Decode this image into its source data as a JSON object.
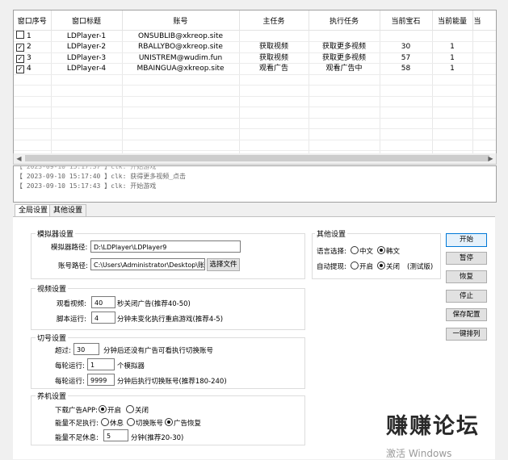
{
  "table": {
    "columns": [
      "窗口序号",
      "窗口标题",
      "账号",
      "主任务",
      "执行任务",
      "当前宝石",
      "当前能量",
      "当"
    ],
    "rows": [
      {
        "checked": false,
        "index": "1",
        "title": "LDPlayer-1",
        "account": "ONSUBLIB@xkreop.site",
        "main_task": "",
        "exec_task": "",
        "gems": "",
        "energy": ""
      },
      {
        "checked": true,
        "index": "2",
        "title": "LDPlayer-2",
        "account": "RBALLYBO@xkreop.site",
        "main_task": "获取视频",
        "exec_task": "获取更多视频",
        "gems": "30",
        "energy": "1"
      },
      {
        "checked": true,
        "index": "3",
        "title": "LDPlayer-3",
        "account": "UNISTREM@wudim.fun",
        "main_task": "获取视频",
        "exec_task": "获取更多视频",
        "gems": "57",
        "energy": "1"
      },
      {
        "checked": true,
        "index": "4",
        "title": "LDPlayer-4",
        "account": "MBAINGUA@xkreop.site",
        "main_task": "观看广告",
        "exec_task": "观看广告中",
        "gems": "58",
        "energy": "1"
      }
    ],
    "extra_mark": "2"
  },
  "log": [
    "【 2023-09-10 15:17:40 】clk: 获得更多视频_点击",
    "【 2023-09-10 15:17:43 】clk: 开始游戏"
  ],
  "tabs": [
    "全局设置",
    "其他设置"
  ],
  "emulator": {
    "group_title": "模拟器设置",
    "path_label": "模拟器路径:",
    "path_value": "D:\\LDPlayer\\LDPlayer9",
    "account_label": "账号路径:",
    "account_value": "C:\\Users\\Administrator\\Desktop\\账号1",
    "choose_file": "选择文件"
  },
  "video": {
    "group_title": "视频设置",
    "watch_label": "观看视频:",
    "watch_value": "40",
    "watch_suffix": "秒关闭广告(推荐40-50)",
    "script_label": "脚本运行:",
    "script_value": "4",
    "script_suffix": "分钟未变化执行重启游戏(推荐4-5)"
  },
  "switch": {
    "group_title": "切号设置",
    "exceed_label": "超过:",
    "exceed_value": "30",
    "exceed_suffix": "分钟后还没有广告可看执行切换账号",
    "per_round_label": "每轮运行:",
    "per_round_value": "1",
    "per_round_suffix": "个模拟器",
    "round_run_label": "每轮运行:",
    "round_run_value": "9999",
    "round_run_suffix": "分钟后执行切换账号(推荐180-240)"
  },
  "nurture": {
    "group_title": "养机设置",
    "download_label": "下载广告APP:",
    "download_on": "开启",
    "download_off": "关闭",
    "low_label": "能量不足执行:",
    "low_opt1": "休息",
    "low_opt2": "切换账号",
    "low_opt3": "广告恢复",
    "rest_label": "能量不足休息:",
    "rest_value": "5",
    "rest_suffix": "分钟(推荐20-30)"
  },
  "other": {
    "group_title": "其他设置",
    "lang_label": "语言选择:",
    "lang_cn": "中文",
    "lang_kr": "韩文",
    "auto_label": "自动提现:",
    "auto_on": "开启",
    "auto_off": "关闭",
    "auto_note": "(测试版)"
  },
  "buttons": {
    "start": "开始",
    "pause": "暂停",
    "resume": "恢复",
    "stop": "停止",
    "save": "保存配置",
    "arrange": "一键排列"
  },
  "watermark": "赚赚论坛",
  "activate": "激活 Windows"
}
